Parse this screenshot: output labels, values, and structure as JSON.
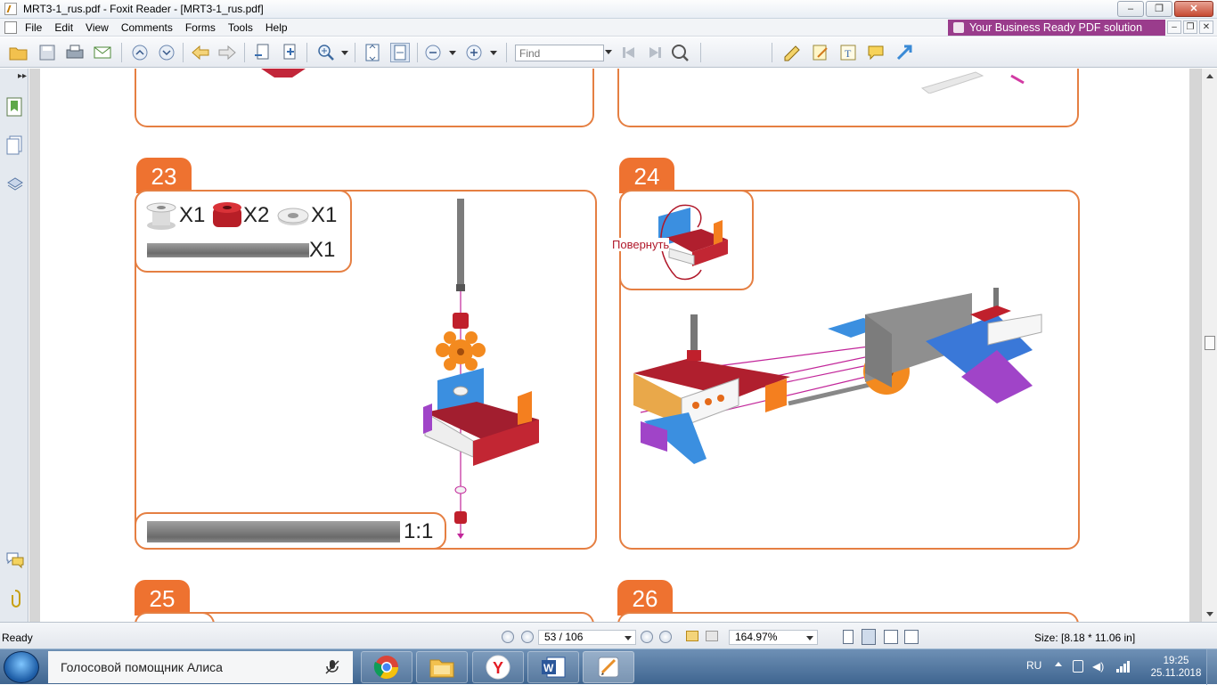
{
  "window": {
    "title": "MRT3-1_rus.pdf - Foxit Reader - [MRT3-1_rus.pdf]",
    "minimize": "–",
    "restore": "❐",
    "close": "✕"
  },
  "menu": {
    "items": [
      "File",
      "Edit",
      "View",
      "Comments",
      "Forms",
      "Tools",
      "Help"
    ],
    "promo": "Your Business Ready PDF solution",
    "doc_min": "–",
    "doc_restore": "❐",
    "doc_close": "✕"
  },
  "toolbar": {
    "find_placeholder": "Find"
  },
  "document": {
    "step_23": {
      "number": "23",
      "parts": [
        "X1",
        "X2",
        "X1",
        "X1"
      ],
      "scale": "1:1"
    },
    "step_24": {
      "number": "24",
      "rotate_label": "Повернуть"
    },
    "step_25": {
      "number": "25"
    },
    "step_26": {
      "number": "26"
    }
  },
  "status": {
    "ready": "Ready",
    "page": "53 / 106",
    "zoom": "164.97%",
    "size": "Size: [8.18 * 11.06 in]"
  },
  "taskbar": {
    "assistant": "Голосовой помощник Алиса",
    "lang": "RU",
    "time": "19:25",
    "date": "25.11.2018"
  },
  "colors": {
    "accent_orange": "#ee7230",
    "panel_border": "#e57f42",
    "promo_bg": "#9a3c8c"
  }
}
